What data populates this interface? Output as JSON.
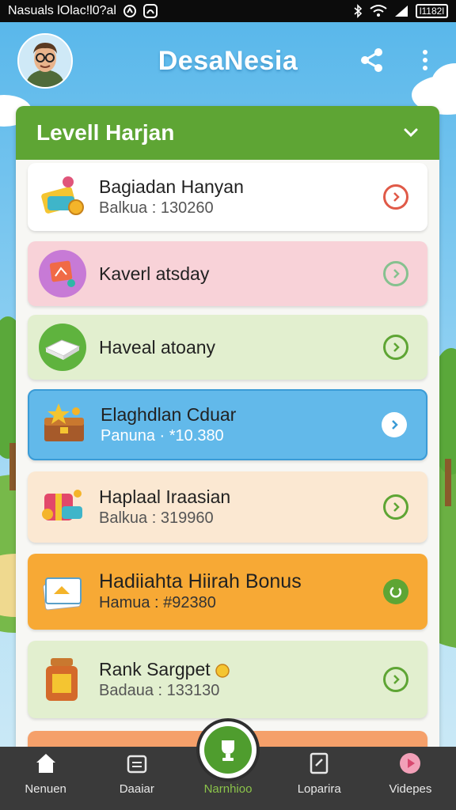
{
  "status_bar": {
    "left_text": "Nasuals lOlac!l0?al",
    "battery": "l1182l"
  },
  "header": {
    "app_title": "DesaNesia"
  },
  "panel": {
    "title": "Levell Harjan"
  },
  "cards": [
    {
      "title": "Bagiadan Hanyan",
      "subtitle": "Balkua : 130260"
    },
    {
      "title": "Kaverl atsday",
      "subtitle": ""
    },
    {
      "title": "Haveal atoany",
      "subtitle": ""
    },
    {
      "title": "Elaghdlan Cduar",
      "subtitle": "Panuna · *10.380"
    },
    {
      "title": "Haplaal Iraasian",
      "subtitle": "Balkua : 319960"
    },
    {
      "title": "Hadiiahta Hiirah Bonus",
      "subtitle": "Hamua : #92380"
    },
    {
      "title": "Rank Sargpet",
      "subtitle": "Badaua : 133130"
    }
  ],
  "bottom_nav": {
    "items": [
      {
        "label": "Nenuen"
      },
      {
        "label": "Daaiar"
      },
      {
        "label": "Narnhioo"
      },
      {
        "label": "Loparira"
      },
      {
        "label": "Videpes"
      }
    ]
  },
  "colors": {
    "green": "#5ea534",
    "blue_card": "#62b9ea",
    "orange_card": "#f7a935",
    "pink_card": "#f8d2d8",
    "lime_card": "#e2efcf",
    "peach_card": "#fbe8d2"
  },
  "icons": {
    "share": "share-icon",
    "more": "more-vertical-icon",
    "chevron": "chevron-down-icon"
  }
}
